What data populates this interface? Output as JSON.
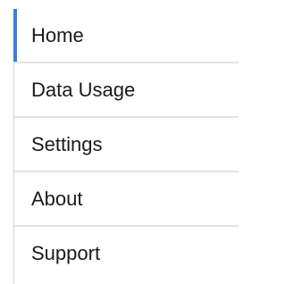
{
  "menu": {
    "active_index": 0,
    "accent_color": "#3b7ddd",
    "items": [
      {
        "label": "Home"
      },
      {
        "label": "Data Usage"
      },
      {
        "label": "Settings"
      },
      {
        "label": "About"
      },
      {
        "label": "Support"
      }
    ]
  }
}
